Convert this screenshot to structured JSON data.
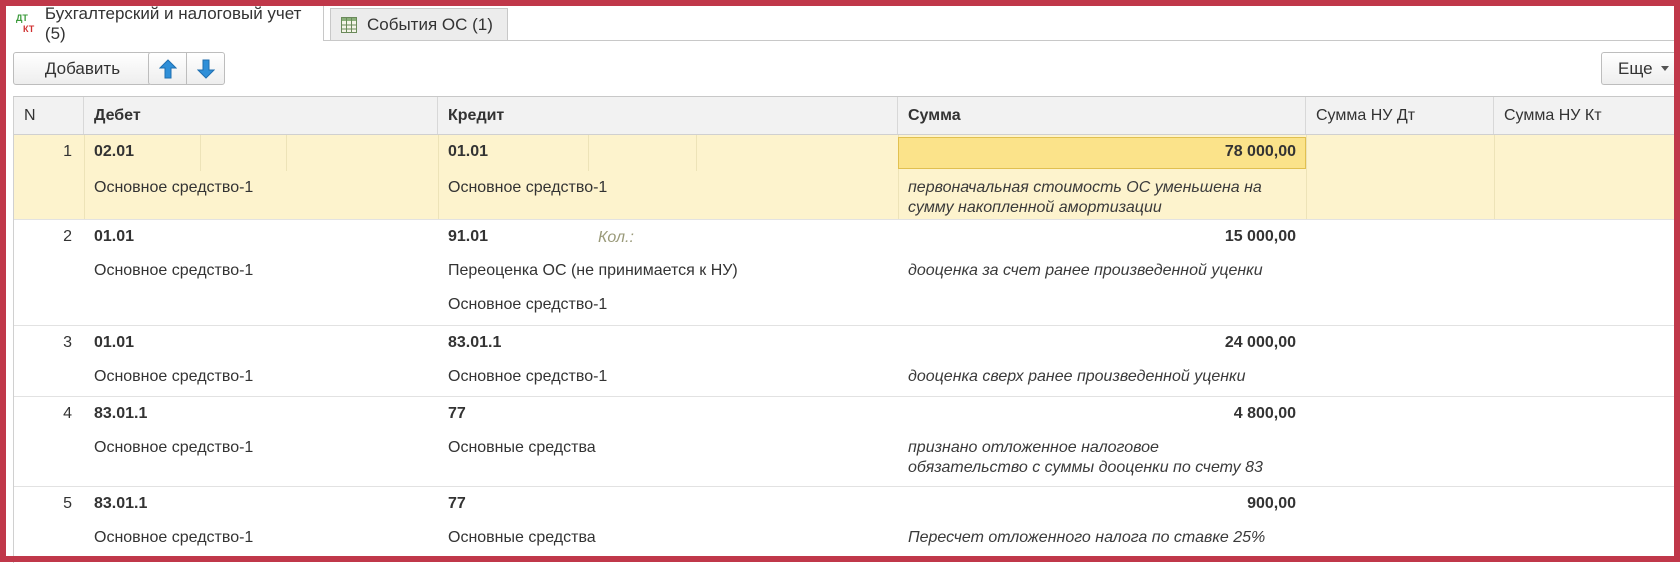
{
  "tabs": [
    {
      "label": "Бухгалтерский и налоговый учет (5)",
      "icon": "dt-kt-icon"
    },
    {
      "label": "События ОС (1)",
      "icon": "table-grid-icon"
    }
  ],
  "toolbar": {
    "add_label": "Добавить",
    "up_icon": "arrow-up-icon",
    "down_icon": "arrow-down-icon",
    "more_label": "Еще"
  },
  "columns": {
    "n": "N",
    "debit": "Дебет",
    "credit": "Кредит",
    "sum": "Сумма",
    "sum_nu_dt": "Сумма НУ Дт",
    "sum_nu_kt": "Сумма НУ Кт"
  },
  "rows": [
    {
      "n": "1",
      "debit_acc": "02.01",
      "debit_sub1": "Основное средство-1",
      "credit_acc": "01.01",
      "credit_sub1": "Основное средство-1",
      "credit_sub2": "",
      "qty_label": "",
      "sum": "78 000,00",
      "content_line1": "первоначальная стоимость ОС уменьшена на",
      "content_line2": "сумму накопленной амортизации"
    },
    {
      "n": "2",
      "debit_acc": "01.01",
      "debit_sub1": "Основное средство-1",
      "credit_acc": "91.01",
      "credit_sub1": "Переоценка ОС (не принимается к НУ)",
      "credit_sub2": "Основное средство-1",
      "qty_label": "Кол.:",
      "sum": "15 000,00",
      "content_line1": "дооценка за счет ранее произведенной уценки",
      "content_line2": ""
    },
    {
      "n": "3",
      "debit_acc": "01.01",
      "debit_sub1": "Основное средство-1",
      "credit_acc": "83.01.1",
      "credit_sub1": "Основное средство-1",
      "credit_sub2": "",
      "qty_label": "",
      "sum": "24 000,00",
      "content_line1": "дооценка сверх ранее произведенной уценки",
      "content_line2": ""
    },
    {
      "n": "4",
      "debit_acc": "83.01.1",
      "debit_sub1": "Основное средство-1",
      "credit_acc": "77",
      "credit_sub1": "Основные средства",
      "credit_sub2": "",
      "qty_label": "",
      "sum": "4 800,00",
      "content_line1": "признано отложенное налоговое",
      "content_line2": "обязательство с суммы дооценки по счету 83"
    },
    {
      "n": "5",
      "debit_acc": "83.01.1",
      "debit_sub1": "Основное средство-1",
      "credit_acc": "77",
      "credit_sub1": "Основные средства",
      "credit_sub2": "",
      "qty_label": "",
      "sum": "900,00",
      "content_line1": "Пересчет отложенного налога по ставке 25%",
      "content_line2": ""
    }
  ],
  "colors": {
    "selected_row": "#fdf3cd",
    "selected_cell": "#fbe38a",
    "frame": "#c0384a"
  }
}
